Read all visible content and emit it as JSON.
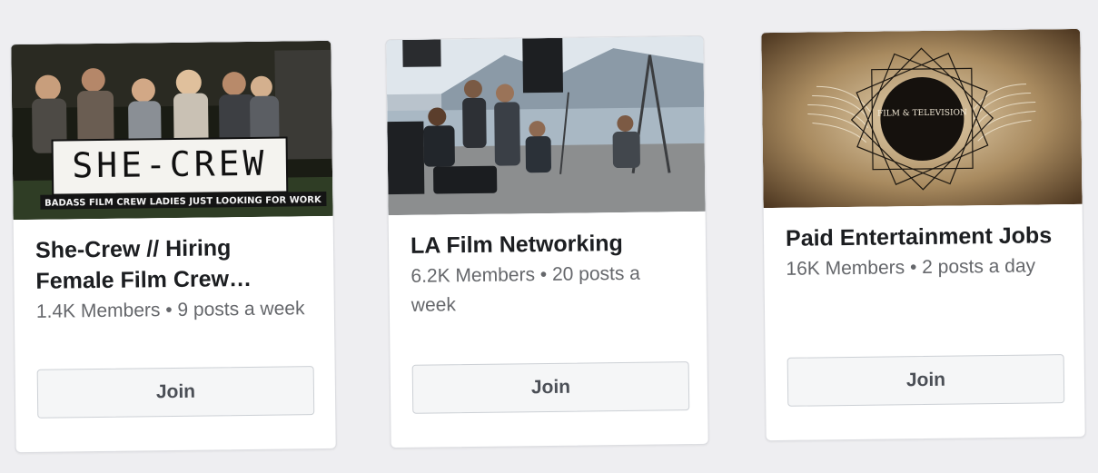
{
  "groups": [
    {
      "cover": {
        "overlay_title": "SHE-CREW",
        "overlay_subtitle": "BADASS FILM CREW LADIES JUST LOOKING FOR WORK"
      },
      "name": "She-Crew // Hiring Female Film Crew…",
      "meta": "1.4K Members • 9 posts a week",
      "join_label": "Join"
    },
    {
      "name": "LA Film Networking",
      "meta": "6.2K Members • 20 posts a week",
      "join_label": "Join"
    },
    {
      "cover": {
        "emblem_text": "FILM & TELEVISION"
      },
      "name": "Paid Entertainment Jobs",
      "meta": "16K Members • 2 posts a day",
      "join_label": "Join"
    }
  ],
  "colors": {
    "page_bg": "#eeeef1",
    "card_bg": "#ffffff",
    "title_text": "#1c1e21",
    "meta_text": "#65676b",
    "button_bg": "#f5f6f7",
    "button_text": "#4b4f56"
  }
}
